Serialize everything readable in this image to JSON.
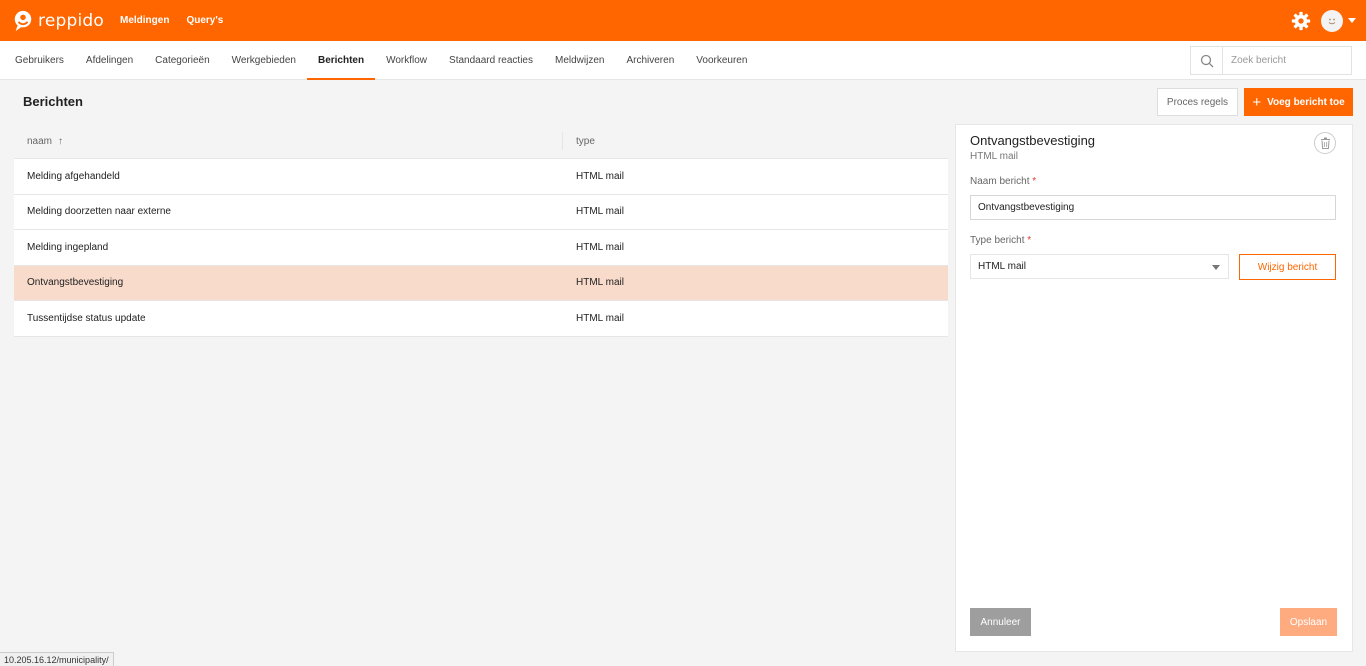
{
  "colors": {
    "brand": "#ff6600",
    "selected_row": "#f9dbcc",
    "save_disabled": "#ffab80",
    "cancel": "#9e9e9e"
  },
  "topbar": {
    "logo_text": "reppido",
    "nav": [
      {
        "label": "Meldingen"
      },
      {
        "label": "Query's"
      }
    ],
    "icons": [
      "logo-icon",
      "gear-icon",
      "avatar-icon",
      "chevron-down-icon"
    ]
  },
  "subnav": {
    "items": [
      {
        "label": "Gebruikers"
      },
      {
        "label": "Afdelingen"
      },
      {
        "label": "Categorieën"
      },
      {
        "label": "Werkgebieden"
      },
      {
        "label": "Berichten",
        "active": true
      },
      {
        "label": "Workflow"
      },
      {
        "label": "Standaard reacties"
      },
      {
        "label": "Meldwijzen"
      },
      {
        "label": "Archiveren"
      },
      {
        "label": "Voorkeuren"
      }
    ],
    "search": {
      "placeholder": "Zoek bericht",
      "value": ""
    }
  },
  "page": {
    "title": "Berichten",
    "process_rules_label": "Proces regels",
    "add_label": "Voeg bericht toe"
  },
  "table": {
    "columns": {
      "name": "naam",
      "type": "type"
    },
    "sort": "naam ascending",
    "rows": [
      {
        "name": "Melding afgehandeld",
        "type": "HTML mail"
      },
      {
        "name": "Melding doorzetten naar externe",
        "type": "HTML mail"
      },
      {
        "name": "Melding ingepland",
        "type": "HTML mail"
      },
      {
        "name": "Ontvangstbevestiging",
        "type": "HTML mail",
        "selected": true
      },
      {
        "name": "Tussentijdse status update",
        "type": "HTML mail"
      }
    ]
  },
  "detail": {
    "title": "Ontvangstbevestiging",
    "subtitle": "HTML mail",
    "name_label": "Naam bericht",
    "name_value": "Ontvangstbevestiging",
    "type_label": "Type bericht",
    "type_value": "HTML mail",
    "required_mark": "*",
    "edit_label": "Wijzig bericht",
    "cancel_label": "Annuleer",
    "save_label": "Opslaan"
  },
  "statusbar": {
    "url": "10.205.16.12/municipality/"
  }
}
